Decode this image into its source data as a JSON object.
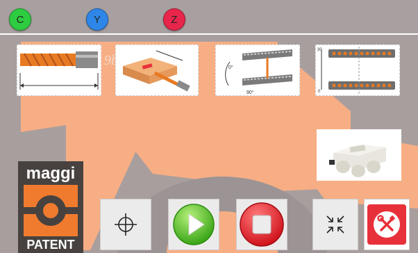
{
  "axes": [
    {
      "label": "C",
      "color": "#2ecc40"
    },
    {
      "label": "Y",
      "color": "#2e86e8"
    },
    {
      "label": "Z",
      "color": "#e8254a"
    }
  ],
  "watermark": "9b",
  "drawing": {
    "angle_0": "0°",
    "angle_90": "90°",
    "dim_30": "30",
    "dim_0": "0"
  },
  "logo": {
    "brand": "maggi",
    "sub": "PATENT"
  },
  "colors": {
    "accent_orange": "#f7ae84",
    "background": "#a89e9e",
    "play_green": "#4fc21e",
    "stop_red": "#e8303a",
    "tools_red": "#e8303a"
  },
  "toolbar": [
    "crosshair-icon",
    "play-icon",
    "stop-icon",
    "collapse-icon",
    "tools-icon"
  ]
}
